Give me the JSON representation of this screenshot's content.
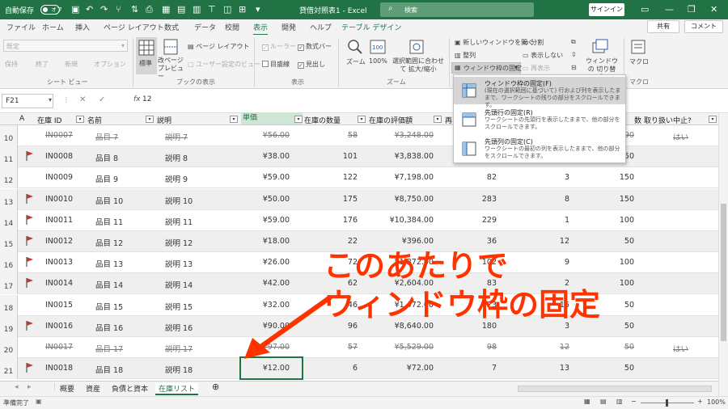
{
  "titlebar": {
    "autosave": "自動保存",
    "autosave_state": "オフ",
    "doc_title": "貸借対照表1 - Excel",
    "search_placeholder": "検索",
    "signin": "サインイン"
  },
  "tabs": [
    "ファイル",
    "ホーム",
    "挿入",
    "ページ レイアウト",
    "数式",
    "データ",
    "校閲",
    "表示",
    "開発",
    "ヘルプ",
    "テーブル デザイン"
  ],
  "tab_buttons": {
    "share": "共有",
    "comment": "コメント"
  },
  "ribbon": {
    "sheetview": {
      "dropdown": "既定",
      "keep": "保持",
      "exit": "終了",
      "new": "新規",
      "options": "オプション",
      "group": "シート ビュー"
    },
    "workbookview": {
      "normal": "標準",
      "pagebreak": "改ページ プレビュー",
      "pagelayout": "ページ レイアウト",
      "custom": "ユーザー設定のビュー",
      "group": "ブックの表示"
    },
    "show": {
      "ruler": "ルーラー",
      "formulabar": "数式バー",
      "gridlines": "目盛線",
      "headings": "見出し",
      "group": "表示"
    },
    "zoom": {
      "zoom": "ズーム",
      "zoom100": "100%",
      "zoomsel": "選択範囲に合わせて 拡大/縮小",
      "group": "ズーム"
    },
    "window": {
      "newwin": "新しいウィンドウを開く",
      "arrange": "整列",
      "freeze": "ウィンドウ枠の固定",
      "split": "分割",
      "hide": "表示しない",
      "unhide": "再表示",
      "switch": "ウィンドウの 切り替え"
    },
    "macro": {
      "label": "マクロ",
      "group": "マクロ"
    }
  },
  "formula": {
    "namebox": "F21",
    "fx": "fx",
    "value": "12"
  },
  "columns": {
    "a": "A",
    "id": "在庫 ID",
    "name": "名前",
    "desc": "説明",
    "price": "単価",
    "qty": "在庫の数量",
    "value": "在庫の評価額",
    "reorder_partial": "再",
    "count_partial": "数",
    "discontinued": "取り扱い中止?"
  },
  "rows": [
    {
      "n": "10",
      "id": "IN0007",
      "name": "品目 7",
      "desc": "説明 7",
      "price": "¥56.00",
      "qty": "58",
      "value": "¥3,248.00",
      "d1": "",
      "d2": "",
      "d3": "90",
      "disc": "はい",
      "flag": false,
      "strike": true
    },
    {
      "n": "11",
      "id": "IN0008",
      "name": "品目 8",
      "desc": "説明 8",
      "price": "¥38.00",
      "qty": "101",
      "value": "¥3,838.00",
      "d1": "",
      "d2": "",
      "d3": "50",
      "disc": "",
      "flag": true,
      "strike": false
    },
    {
      "n": "12",
      "id": "IN0009",
      "name": "品目 9",
      "desc": "説明 9",
      "price": "¥59.00",
      "qty": "122",
      "value": "¥7,198.00",
      "d1": "82",
      "d2": "3",
      "d3": "150",
      "disc": "",
      "flag": false,
      "strike": false
    },
    {
      "n": "13",
      "id": "IN0010",
      "name": "品目 10",
      "desc": "説明 10",
      "price": "¥50.00",
      "qty": "175",
      "value": "¥8,750.00",
      "d1": "283",
      "d2": "8",
      "d3": "150",
      "disc": "",
      "flag": true,
      "strike": false
    },
    {
      "n": "14",
      "id": "IN0011",
      "name": "品目 11",
      "desc": "説明 11",
      "price": "¥59.00",
      "qty": "176",
      "value": "¥10,384.00",
      "d1": "229",
      "d2": "1",
      "d3": "100",
      "disc": "",
      "flag": true,
      "strike": false
    },
    {
      "n": "15",
      "id": "IN0012",
      "name": "品目 12",
      "desc": "説明 12",
      "price": "¥18.00",
      "qty": "22",
      "value": "¥396.00",
      "d1": "36",
      "d2": "12",
      "d3": "50",
      "disc": "",
      "flag": true,
      "strike": false
    },
    {
      "n": "16",
      "id": "IN0013",
      "name": "品目 13",
      "desc": "説明 13",
      "price": "¥26.00",
      "qty": "72",
      "value": "¥1,872.00",
      "d1": "102",
      "d2": "9",
      "d3": "100",
      "disc": "",
      "flag": true,
      "strike": false
    },
    {
      "n": "17",
      "id": "IN0014",
      "name": "品目 14",
      "desc": "説明 14",
      "price": "¥42.00",
      "qty": "62",
      "value": "¥2,604.00",
      "d1": "83",
      "d2": "2",
      "d3": "100",
      "disc": "",
      "flag": true,
      "strike": false
    },
    {
      "n": "18",
      "id": "IN0015",
      "name": "品目 15",
      "desc": "説明 15",
      "price": "¥32.00",
      "qty": "46",
      "value": "¥1,472.00",
      "d1": "23",
      "d2": "15",
      "d3": "50",
      "disc": "",
      "flag": false,
      "strike": false
    },
    {
      "n": "19",
      "id": "IN0016",
      "name": "品目 16",
      "desc": "説明 16",
      "price": "¥90.00",
      "qty": "96",
      "value": "¥8,640.00",
      "d1": "180",
      "d2": "3",
      "d3": "50",
      "disc": "",
      "flag": true,
      "strike": false
    },
    {
      "n": "20",
      "id": "IN0017",
      "name": "品目 17",
      "desc": "説明 17",
      "price": "¥97.00",
      "qty": "57",
      "value": "¥5,529.00",
      "d1": "98",
      "d2": "12",
      "d3": "50",
      "disc": "はい",
      "flag": false,
      "strike": true
    },
    {
      "n": "21",
      "id": "IN0018",
      "name": "品目 18",
      "desc": "説明 18",
      "price": "¥12.00",
      "qty": "6",
      "value": "¥72.00",
      "d1": "7",
      "d2": "13",
      "d3": "50",
      "disc": "",
      "flag": true,
      "strike": false
    }
  ],
  "sheets": [
    "概要",
    "資産",
    "負債と資本",
    "在庫リスト"
  ],
  "status": {
    "ready": "準備完了",
    "zoom": "100%"
  },
  "freeze_menu": [
    {
      "title": "ウィンドウ枠の固定(F)",
      "desc": "(現在の選択範囲に基づいて) 行および列を表示したままで、ワークシートの残りの部分をスクロールできます。"
    },
    {
      "title": "先頭行の固定(R)",
      "desc": "ワークシートの先頭行を表示したままで、他の部分をスクロールできます。"
    },
    {
      "title": "先頭列の固定(C)",
      "desc": "ワークシートの最初の列を表示したままで、他の部分をスクロールできます。"
    }
  ],
  "annotation": {
    "line1": "このあたりで",
    "line2": "ウィンドウ枠の固定"
  },
  "colors": {
    "excel_green": "#217346",
    "flag_red": "#c0392b",
    "annotation_red": "#ff3300"
  }
}
